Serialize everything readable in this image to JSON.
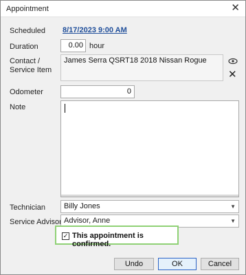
{
  "window": {
    "title": "Appointment"
  },
  "fields": {
    "scheduled_label": "Scheduled",
    "scheduled_value": "8/17/2023 9:00 AM",
    "duration_label": "Duration",
    "duration_value": "0.00",
    "duration_unit": "hour",
    "contact_label_line1": "Contact /",
    "contact_label_line2": "Service Item",
    "contact_value": "James Serra QSRT18 2018 Nissan Rogue",
    "odometer_label": "Odometer",
    "odometer_value": "0",
    "note_label": "Note",
    "note_value": "",
    "technician_label": "Technician",
    "technician_value": "Billy Jones",
    "advisor_label": "Service Advisor",
    "advisor_value": "Advisor, Anne"
  },
  "confirm": {
    "label": "This appointment is confirmed.",
    "checked": true
  },
  "buttons": {
    "undo": "Undo",
    "ok": "OK",
    "cancel": "Cancel"
  },
  "icons": {
    "close": "close-icon",
    "view": "eye-icon",
    "remove": "delete-x-icon",
    "dropdown": "chevron-down-icon",
    "check": "checkmark-icon"
  },
  "colors": {
    "link": "#1f4e9a",
    "highlight_border": "#8fd175",
    "ok_border": "#2b63c6"
  }
}
